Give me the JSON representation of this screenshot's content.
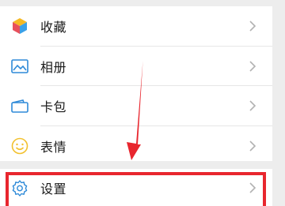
{
  "menu": {
    "items": [
      {
        "label": "收藏",
        "icon": "favorites-cube-icon"
      },
      {
        "label": "相册",
        "icon": "photo-album-icon"
      },
      {
        "label": "卡包",
        "icon": "card-wallet-icon"
      },
      {
        "label": "表情",
        "icon": "smiley-face-icon"
      }
    ],
    "settings": {
      "label": "设置",
      "icon": "gear-icon"
    }
  },
  "annotation": {
    "arrow_color": "#e8262e",
    "highlight_color": "#e8262e"
  }
}
